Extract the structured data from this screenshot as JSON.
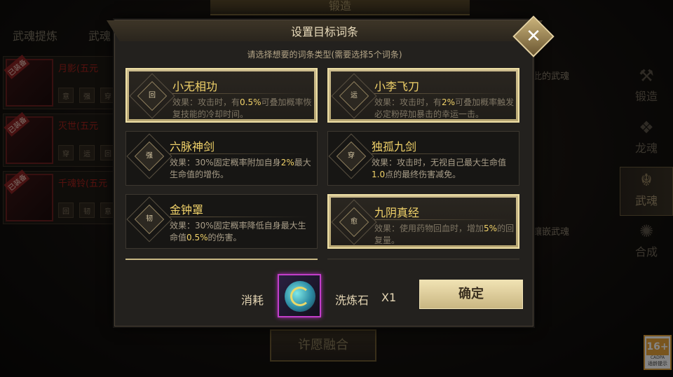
{
  "background": {
    "top_banner": "锻造",
    "tabs": [
      "武魂提炼",
      "武魂"
    ],
    "items": [
      {
        "tag": "已装备",
        "name": "月影(五元",
        "subs": [
          "意",
          "强",
          "穿"
        ]
      },
      {
        "tag": "已装备",
        "name": "灭世(五元",
        "subs": [
          "穿",
          "运",
          "回"
        ]
      },
      {
        "tag": "已装备",
        "name": "千魂铃(五元",
        "subs": [
          "回",
          "韧",
          "意"
        ]
      }
    ],
    "right_text_1": "此的武魂",
    "right_text_2": "镶嵌武魂",
    "side_nav": [
      {
        "label": "锻造",
        "icon": "anvil-icon"
      },
      {
        "label": "龙魂",
        "icon": "dragon-icon"
      },
      {
        "label": "武魂",
        "icon": "soul-icon",
        "active": true
      },
      {
        "label": "合成",
        "icon": "swirl-icon"
      }
    ],
    "wish_button": "许愿融合",
    "age_badge": {
      "rating": "16+",
      "small": "CADPA",
      "tip": "适龄提示"
    }
  },
  "modal": {
    "title": "设置目标词条",
    "subtitle": "请选择想要的词条类型(需要选择5个词条)",
    "cards": [
      {
        "emblem": "回",
        "name": "小无相功",
        "selected": true,
        "desc_parts": [
          {
            "t": "效果：攻击时，有"
          },
          {
            "t": "0.5%",
            "hl": true
          },
          {
            "t": "可叠加概率恢复技能的冷却时间。"
          }
        ]
      },
      {
        "emblem": "运",
        "name": "小李飞刀",
        "selected": true,
        "desc_parts": [
          {
            "t": "效果：攻击时，有"
          },
          {
            "t": "2%",
            "hl": true
          },
          {
            "t": "可叠加概率触发必定粉碎加暴击的幸运一击。"
          }
        ]
      },
      {
        "emblem": "强",
        "name": "六脉神剑",
        "selected": false,
        "desc_parts": [
          {
            "t": "效果：30%固定概率附加自身"
          },
          {
            "t": "2%",
            "hl": true
          },
          {
            "t": "最大生命值的增伤。"
          }
        ]
      },
      {
        "emblem": "穿",
        "name": "独孤九剑",
        "selected": false,
        "desc_parts": [
          {
            "t": "效果：攻击时，无视自己最大生命值"
          },
          {
            "t": "1.0",
            "hl": true
          },
          {
            "t": "点的最终伤害减免。"
          }
        ]
      },
      {
        "emblem": "韧",
        "name": "金钟罩",
        "selected": false,
        "desc_parts": [
          {
            "t": "效果：30%固定概率降低自身最大生命值"
          },
          {
            "t": "0.5%",
            "hl": true
          },
          {
            "t": "的伤害。"
          }
        ]
      },
      {
        "emblem": "愈",
        "name": "九阴真经",
        "selected": true,
        "desc_parts": [
          {
            "t": "效果：使用药物回血时，增加"
          },
          {
            "t": "5%",
            "hl": true
          },
          {
            "t": "的回复量。"
          }
        ]
      }
    ],
    "cost_label": "消耗",
    "stone_name": "洗炼石",
    "stone_count": "X1",
    "confirm_label": "确定",
    "close_symbol": "✕"
  }
}
